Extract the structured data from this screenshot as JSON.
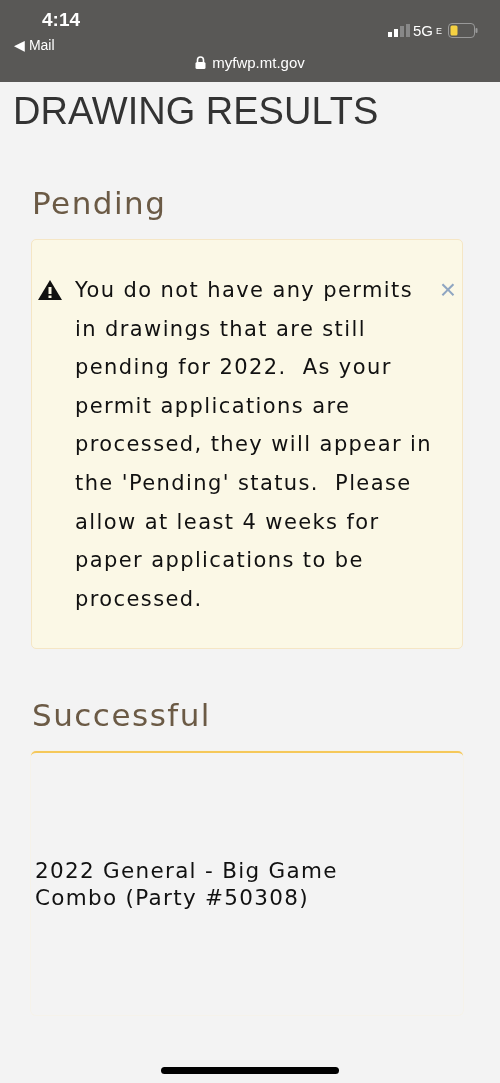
{
  "status_bar": {
    "time": "4:14",
    "back_app": "◀ Mail",
    "network": "5G",
    "network_sub": "E",
    "url": "myfwp.mt.gov"
  },
  "page_title": "DRAWING RESULTS",
  "sections": [
    {
      "heading": "Pending",
      "kind": "alert",
      "message": "You do not have any permits in drawings that are still pending for 2022.  As your permit applications are processed, they will appear in the 'Pending' status.  Please allow at least 4 weeks for paper applications to be processed.",
      "close": "×"
    },
    {
      "heading": "Successful",
      "kind": "card",
      "item": "2022 General - Big Game Combo (Party #50308)"
    }
  ]
}
